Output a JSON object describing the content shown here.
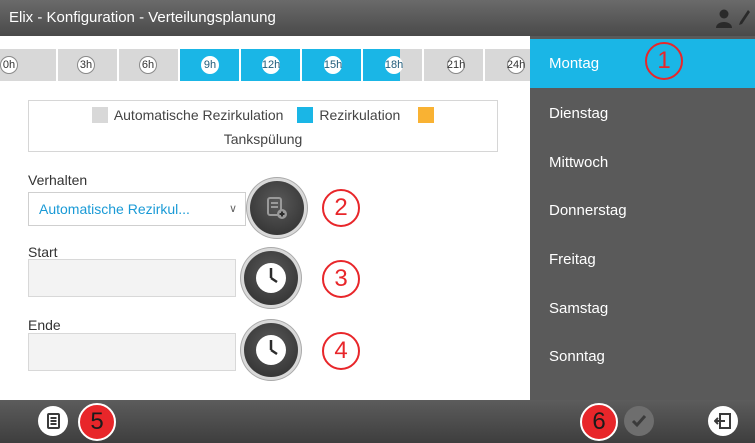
{
  "window": {
    "title": "Elix - Konfiguration - Verteilungsplanung"
  },
  "timeline": {
    "ticks": [
      "0h",
      "3h",
      "6h",
      "9h",
      "12h",
      "15h",
      "18h",
      "21h",
      "24h"
    ]
  },
  "legend": {
    "auto_recirc": "Automatische Rezirkulation",
    "recirc": "Rezirkulation",
    "tank_flush": "Tankspülung",
    "colors": {
      "auto_recirc": "#d8d8d8",
      "recirc": "#1ab6e6",
      "tank_flush": "#f9b233"
    }
  },
  "form": {
    "behavior_label": "Verhalten",
    "behavior_value": "Automatische Rezirkul...",
    "start_label": "Start",
    "start_value": "",
    "end_label": "Ende",
    "end_value": ""
  },
  "markers": [
    "1",
    "2",
    "3",
    "4",
    "5",
    "6"
  ],
  "days": [
    "Montag",
    "Dienstag",
    "Mittwoch",
    "Donnerstag",
    "Freitag",
    "Samstag",
    "Sonntag"
  ],
  "selected_day": "Montag",
  "colors": {
    "accent": "#1ab6e6",
    "marker": "#e8262a",
    "sidebar": "#5a5a5a"
  }
}
